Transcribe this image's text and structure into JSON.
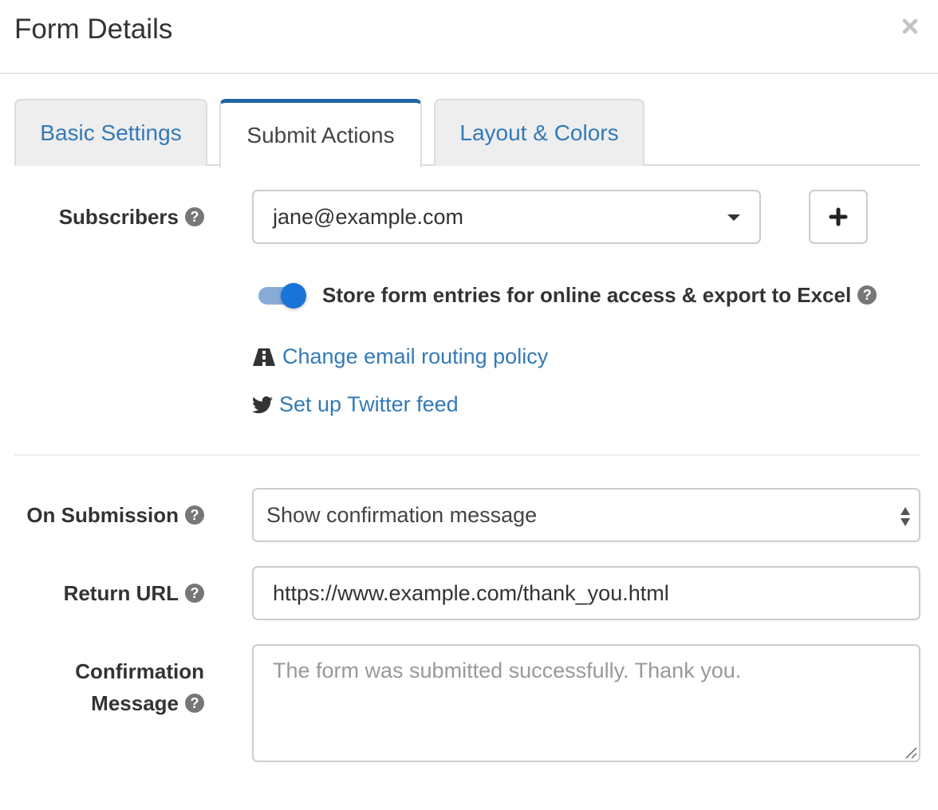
{
  "header": {
    "title": "Form Details",
    "close_icon": "close-icon"
  },
  "tabs": [
    {
      "label": "Basic Settings",
      "active": false
    },
    {
      "label": "Submit Actions",
      "active": true
    },
    {
      "label": "Layout & Colors",
      "active": false
    }
  ],
  "subscribers": {
    "label": "Subscribers",
    "selected": "jane@example.com",
    "add_button_icon": "plus-icon"
  },
  "store_entries": {
    "label": "Store form entries for online access & export to Excel",
    "enabled": true
  },
  "links": {
    "routing": {
      "label": "Change email routing policy",
      "icon": "road-icon"
    },
    "twitter": {
      "label": "Set up Twitter feed",
      "icon": "twitter-icon"
    }
  },
  "on_submission": {
    "label": "On Submission",
    "selected": "Show confirmation message"
  },
  "return_url": {
    "label": "Return URL",
    "value": "https://www.example.com/thank_you.html"
  },
  "confirmation_message": {
    "label_line1": "Confirmation",
    "label_line2": "Message",
    "placeholder": "The form was submitted successfully. Thank you."
  },
  "colors": {
    "link": "#337ab7",
    "active_tab_accent": "#1f66a8",
    "toggle_on": "#1a73d9"
  }
}
